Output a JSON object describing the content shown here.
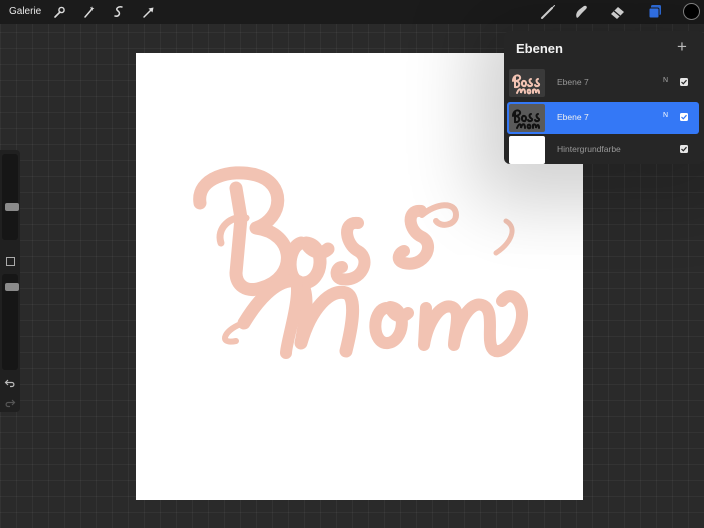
{
  "toolbar": {
    "gallery_label": "Galerie",
    "left_tools": [
      "wrench-icon",
      "magic-wand-icon",
      "selection-icon",
      "transform-arrow-icon"
    ],
    "right_tools": [
      "brush-icon",
      "smudge-icon",
      "eraser-icon",
      "layers-icon"
    ],
    "current_color": "#000000",
    "active_accent": "#3478f6"
  },
  "canvas": {
    "background": "#ffffff",
    "lettering_color": "#f2c3b3",
    "lettering_words": [
      "Boss",
      "Mom"
    ]
  },
  "sidebar": {
    "size_slider_level": 0.36,
    "opacity_slider_level": 0.22
  },
  "layers_panel": {
    "title": "Ebenen",
    "add_symbol": "+",
    "layers": [
      {
        "name": "Ebene 7",
        "blend": "N",
        "visible": true,
        "active": false
      },
      {
        "name": "Ebene 7",
        "blend": "N",
        "visible": true,
        "active": true
      },
      {
        "name": "Hintergrundfarbe",
        "blend": "",
        "visible": true,
        "active": false
      }
    ]
  }
}
